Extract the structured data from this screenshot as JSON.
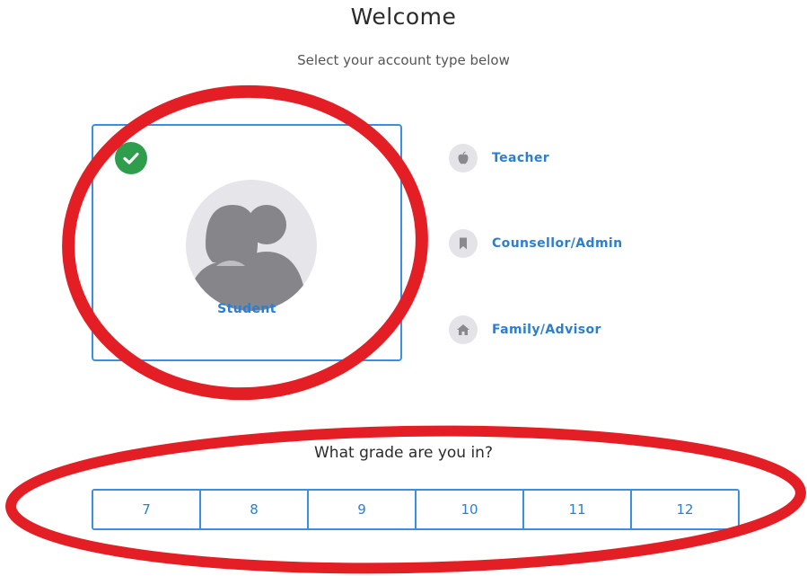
{
  "header": {
    "title": "Welcome",
    "subtitle": "Select your account type below"
  },
  "account_types": {
    "selected": {
      "label": "Student",
      "icon": "student-avatar-icon",
      "check_icon": "checkmark-icon"
    },
    "options": [
      {
        "label": "Teacher",
        "icon": "apple-icon"
      },
      {
        "label": "Counsellor/Admin",
        "icon": "bookmark-icon"
      },
      {
        "label": "Family/Advisor",
        "icon": "home-icon"
      }
    ]
  },
  "grade": {
    "question": "What grade are you in?",
    "options": [
      "7",
      "8",
      "9",
      "10",
      "11",
      "12"
    ]
  },
  "colors": {
    "accent": "#3a8ee6",
    "link": "#2b7fd0",
    "check_badge": "#2e9e4d",
    "annotation": "#e31e24"
  }
}
